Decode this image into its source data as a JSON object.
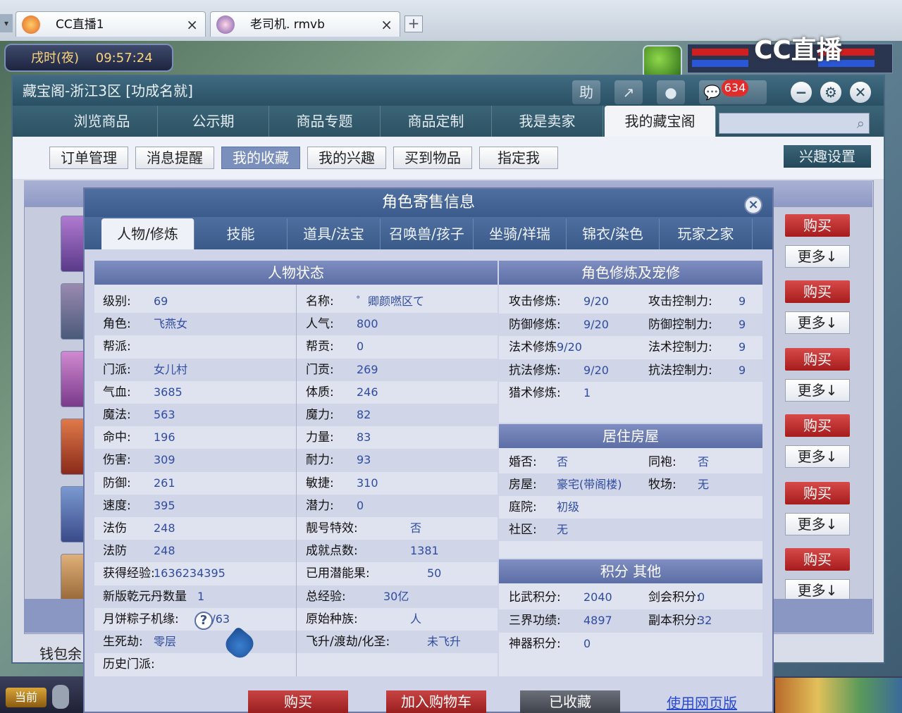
{
  "browser": {
    "tabs": [
      {
        "label": "CC直播1",
        "close": "×"
      },
      {
        "label": "老司机. rmvb",
        "close": "×"
      }
    ],
    "new_tab": "+"
  },
  "hud": {
    "time_of_day": "戌时(夜)",
    "clock": "09:57:24",
    "logo": "CC直播"
  },
  "shop": {
    "title": "藏宝阁-浙江3区 [功成名就]",
    "top_icons": [
      "助",
      "↗",
      "●",
      "💬"
    ],
    "message_count": "634",
    "window_buttons": [
      "−",
      "⚙",
      "✕"
    ],
    "nav": [
      "浏览商品",
      "公示期",
      "商品专题",
      "商品定制",
      "我是卖家",
      "我的藏宝阁"
    ],
    "nav_active": "我的藏宝阁",
    "search_icon": "⌕",
    "subnav": [
      "订单管理",
      "消息提醒",
      "我的收藏",
      "我的兴趣",
      "买到物品",
      "指定我"
    ],
    "subnav_active": "我的收藏",
    "interest_settings": "兴趣设置",
    "buy_label": "购买",
    "more_label": "更多↓",
    "wallet": "钱包余"
  },
  "bottom": {
    "current": "当前"
  },
  "modal": {
    "title": "角色寄售信息",
    "close": "×",
    "tabs": [
      "人物/修炼",
      "技能",
      "道具/法宝",
      "召唤兽/孩子",
      "坐骑/祥瑞",
      "锦衣/染色",
      "玩家之家"
    ],
    "tab_active": "人物/修炼",
    "status_header": "人物状态",
    "cultivation_header": "角色修炼及宠修",
    "house_header": "居住房屋",
    "points_header": "积分 其他",
    "status_left": [
      {
        "label": "级别:",
        "value": "69"
      },
      {
        "label": "角色:",
        "value": "飞燕女"
      },
      {
        "label": "帮派:",
        "value": ""
      },
      {
        "label": "门派:",
        "value": "女儿村"
      },
      {
        "label": "气血:",
        "value": "3685"
      },
      {
        "label": "魔法:",
        "value": "563"
      },
      {
        "label": "命中:",
        "value": "196"
      },
      {
        "label": "伤害:",
        "value": "309"
      },
      {
        "label": "防御:",
        "value": "261"
      },
      {
        "label": "速度:",
        "value": "395"
      },
      {
        "label": "法伤",
        "value": "248"
      },
      {
        "label": "法防",
        "value": "248"
      },
      {
        "label": "获得经验:",
        "value": "1636234395"
      },
      {
        "label": "新版乾元丹数量",
        "value": "1"
      },
      {
        "label": "月饼粽子机缘:",
        "value": "19/63"
      },
      {
        "label": "生死劫:",
        "value": "零层"
      },
      {
        "label": "历史门派:",
        "value": ""
      }
    ],
    "status_right": [
      {
        "label": "名称:",
        "value": "゜卿颜嘫区て"
      },
      {
        "label": "人气:",
        "value": "800"
      },
      {
        "label": "帮贡:",
        "value": "0"
      },
      {
        "label": "门贡:",
        "value": "269"
      },
      {
        "label": "体质:",
        "value": "246"
      },
      {
        "label": "魔力:",
        "value": "82"
      },
      {
        "label": "力量:",
        "value": "83"
      },
      {
        "label": "耐力:",
        "value": "93"
      },
      {
        "label": "敏捷:",
        "value": "310"
      },
      {
        "label": "潜力:",
        "value": "0"
      },
      {
        "label": "靓号特效:",
        "value": "否"
      },
      {
        "label": "成就点数:",
        "value": "1381"
      },
      {
        "label": "已用潜能果:",
        "value": "50"
      },
      {
        "label": "总经验:",
        "value": "30亿"
      },
      {
        "label": "原始种族:",
        "value": "人"
      },
      {
        "label": "飞升/渡劫/化圣:",
        "value": "未飞升"
      }
    ],
    "cultivation": [
      {
        "label": "攻击修炼:",
        "value": "9/20",
        "label2": "攻击控制力:",
        "value2": "9"
      },
      {
        "label": "防御修炼:",
        "value": "9/20",
        "label2": "防御控制力:",
        "value2": "9"
      },
      {
        "label": "法术修炼",
        "value": "9/20",
        "label2": "法术控制力:",
        "value2": "9"
      },
      {
        "label": "抗法修炼:",
        "value": "9/20",
        "label2": "抗法控制力:",
        "value2": "9"
      },
      {
        "label": "猎术修炼:",
        "value": "1",
        "label2": "",
        "value2": ""
      }
    ],
    "house": [
      {
        "label": "婚否:",
        "value": "否",
        "label2": "同袍:",
        "value2": "否"
      },
      {
        "label": "房屋:",
        "value": "豪宅(带阁楼)",
        "label2": "牧场:",
        "value2": "无"
      },
      {
        "label": "庭院:",
        "value": "初级",
        "label2": "",
        "value2": ""
      },
      {
        "label": "社区:",
        "value": "无",
        "label2": "",
        "value2": ""
      }
    ],
    "points": [
      {
        "label": "比武积分:",
        "value": "2040",
        "label2": "剑会积分:",
        "value2": "0"
      },
      {
        "label": "三界功绩:",
        "value": "4897",
        "label2": "副本积分:",
        "value2": "32"
      },
      {
        "label": "神器积分:",
        "value": "0",
        "label2": "",
        "value2": ""
      }
    ],
    "help": "?",
    "actions": {
      "buy": "购买",
      "add_cart": "加入购物车",
      "favorited": "已收藏",
      "web": "使用网页版"
    }
  }
}
